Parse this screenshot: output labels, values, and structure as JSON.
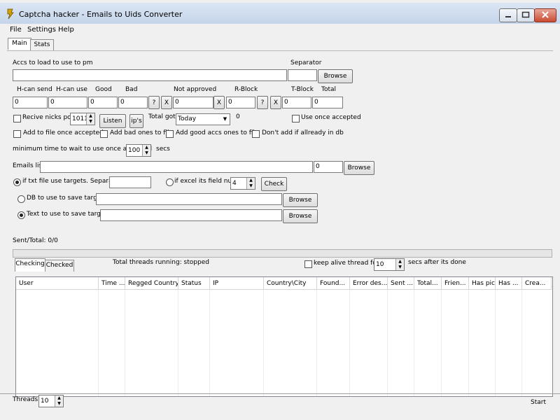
{
  "window": {
    "title": "Captcha hacker - Emails to Uids Converter"
  },
  "menu": [
    "File",
    "Settings",
    "Help"
  ],
  "tabs": {
    "main": "Main",
    "stats": "Stats"
  },
  "accs": {
    "label": "Accs to load to use to pm",
    "value": "",
    "separator_label": "Separator",
    "separator_value": "",
    "browse": "Browse"
  },
  "counters": {
    "labels": [
      "H-can send",
      "H-can use",
      "Good",
      "Bad",
      "Not approved",
      "R-Block",
      "T-Block",
      "Total"
    ],
    "values": [
      "0",
      "0",
      "0",
      "0",
      "0",
      "0",
      "0",
      "0"
    ],
    "question": "?",
    "x": "X"
  },
  "nicks": {
    "recive_label": "Recive nicks port",
    "port": "1011",
    "listen": "Listen",
    "ips": "ip's",
    "total_got_label": "Total got",
    "period": "Today",
    "total_got_value": "0",
    "use_once_label": "Use once accepted"
  },
  "options": {
    "add_file_once": "Add to file once accepted",
    "add_bad": "Add bad ones to file",
    "add_good": "Add good accs ones to file",
    "dont_add": "Don't add if allready in db"
  },
  "wait": {
    "label": "minimum time to wait to use once accepted",
    "value": "100",
    "unit": "secs"
  },
  "emails": {
    "label": "Emails list",
    "value": "",
    "count": "0",
    "browse": "Browse"
  },
  "targets": {
    "txt_label": "if txt file use targets. Separator:",
    "txt_sep": "",
    "excel_label": "if excel its field num",
    "excel_field": "4",
    "check": "Check",
    "db_label": "DB to use to save targets",
    "db_value": "",
    "text_label": "Text to use to save targets",
    "text_value": "",
    "browse": "Browse"
  },
  "sent": {
    "label": "Sent/Total: 0/0",
    "progress": 0
  },
  "threads_panel": {
    "tab_checking": "Checking",
    "tab_checked": "Checked",
    "running": "Total threads running: stopped",
    "keep_alive": "keep alive thread for",
    "keep_alive_value": "10",
    "after": "secs after its done"
  },
  "table": {
    "columns": [
      "User",
      "Time ...",
      "Regged Country",
      "Status",
      "IP",
      "Country\\City",
      "Found...",
      "Error des...",
      "Sent ...",
      "Total...",
      "Frien...",
      "Has pic",
      "Has ...",
      "Crea..."
    ],
    "rows": []
  },
  "footer": {
    "threads_label": "Threads:",
    "threads_value": "10",
    "start": "Start"
  }
}
